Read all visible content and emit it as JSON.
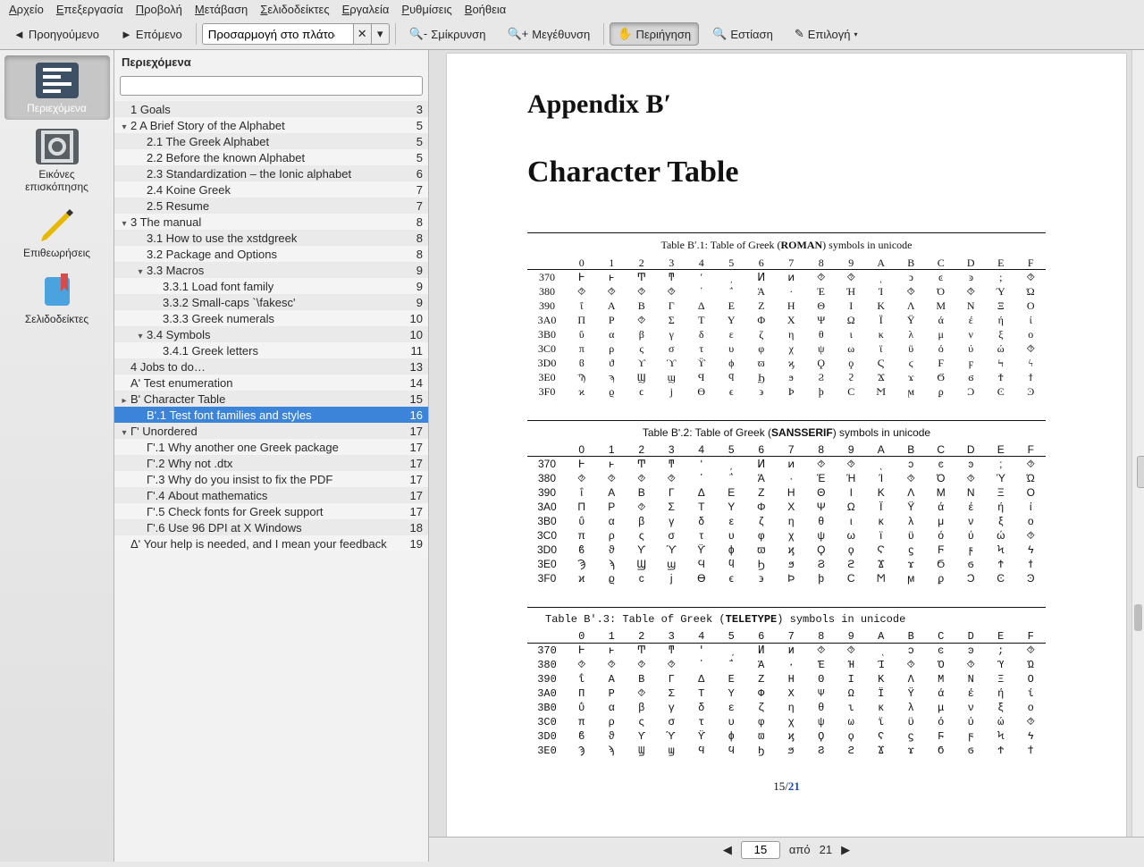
{
  "menu": [
    "Αρχείο",
    "Επεξεργασία",
    "Προβολή",
    "Μετάβαση",
    "Σελιδοδείκτες",
    "Εργαλεία",
    "Ρυθμίσεις",
    "Βοήθεια"
  ],
  "toolbar": {
    "prev": "Προηγούμενο",
    "next": "Επόμενο",
    "zoom_value": "Προσαρμογή στο πλάτος",
    "zoom_out": "Σμίκρυνση",
    "zoom_in": "Μεγέθυνση",
    "browse": "Περιήγηση",
    "focus": "Εστίαση",
    "select": "Επιλογή"
  },
  "sidebar_tabs": {
    "contents": "Περιεχόμενα",
    "thumbnails": "Εικόνες επισκόπησης",
    "reviews": "Επιθεωρήσεις",
    "bookmarks": "Σελιδοδείκτες"
  },
  "panel_title": "Περιεχόμενα",
  "toc": [
    {
      "d": 1,
      "t": "",
      "l": "1 Goals",
      "p": "3"
    },
    {
      "d": 1,
      "t": "v",
      "l": "2 A Brief Story of the Alphabet",
      "p": "5"
    },
    {
      "d": 2,
      "t": "",
      "l": "2.1 The Greek Alphabet",
      "p": "5"
    },
    {
      "d": 2,
      "t": "",
      "l": "2.2 Before the known Alphabet",
      "p": "5"
    },
    {
      "d": 2,
      "t": "",
      "l": "2.3 Standardization – the Ionic alphabet",
      "p": "6"
    },
    {
      "d": 2,
      "t": "",
      "l": "2.4 Koine Greek",
      "p": "7"
    },
    {
      "d": 2,
      "t": "",
      "l": "2.5 Resume",
      "p": "7"
    },
    {
      "d": 1,
      "t": "v",
      "l": "3 The manual",
      "p": "8"
    },
    {
      "d": 2,
      "t": "",
      "l": "3.1 How to use the xstdgreek",
      "p": "8"
    },
    {
      "d": 2,
      "t": "",
      "l": "3.2 Package and Options",
      "p": "8"
    },
    {
      "d": 2,
      "t": "v",
      "l": "3.3 Macros",
      "p": "9"
    },
    {
      "d": 3,
      "t": "",
      "l": "3.3.1 Load font family",
      "p": "9"
    },
    {
      "d": 3,
      "t": "",
      "l": "3.3.2 Small-caps `\\fakesc'",
      "p": "9"
    },
    {
      "d": 3,
      "t": "",
      "l": "3.3.3 Greek numerals",
      "p": "10"
    },
    {
      "d": 2,
      "t": "v",
      "l": "3.4 Symbols",
      "p": "10"
    },
    {
      "d": 3,
      "t": "",
      "l": "3.4.1 Greek letters",
      "p": "11"
    },
    {
      "d": 1,
      "t": "",
      "l": "4 Jobs to do…",
      "p": "13"
    },
    {
      "d": 1,
      "t": "",
      "l": "Αʹ Test enumeration",
      "p": "14"
    },
    {
      "d": 1,
      "t": ">",
      "l": "Βʹ Character Table",
      "p": "15"
    },
    {
      "d": 2,
      "t": "",
      "l": "Βʹ.1 Test font families and styles",
      "p": "16",
      "sel": true
    },
    {
      "d": 1,
      "t": "v",
      "l": "Γʹ Unordered",
      "p": "17"
    },
    {
      "d": 2,
      "t": "",
      "l": "Γʹ.1 Why another one Greek package",
      "p": "17"
    },
    {
      "d": 2,
      "t": "",
      "l": "Γʹ.2 Why not .dtx",
      "p": "17"
    },
    {
      "d": 2,
      "t": "",
      "l": "Γʹ.3 Why do you insist to fix the PDF",
      "p": "17"
    },
    {
      "d": 2,
      "t": "",
      "l": "Γʹ.4 About mathematics",
      "p": "17"
    },
    {
      "d": 2,
      "t": "",
      "l": "Γʹ.5 Check fonts for Greek support",
      "p": "17"
    },
    {
      "d": 2,
      "t": "",
      "l": "Γʹ.6 Use 96 DPI at X Windows",
      "p": "18"
    },
    {
      "d": 1,
      "t": "",
      "l": "Δʹ Your help is needed, and I mean your feedback",
      "p": "19"
    }
  ],
  "doc": {
    "h1": "Appendix Bʹ",
    "h2": "Character Table",
    "table1_cap_pre": "Table Bʹ.1: Table of Greek (",
    "table1_cap_b": "ROMAN",
    "table1_cap_post": ") symbols in unicode",
    "table2_cap_pre": "Table Bʹ.2: Table of Greek (",
    "table2_cap_b": "SANSSERIF",
    "table2_cap_post": ") symbols in unicode",
    "table3_cap_pre": "Table Bʹ.3: Table of Greek (",
    "table3_cap_b": "TELETYPE",
    "table3_cap_post": ") symbols in unicode",
    "cols": [
      "0",
      "1",
      "2",
      "3",
      "4",
      "5",
      "6",
      "7",
      "8",
      "9",
      "A",
      "B",
      "C",
      "D",
      "E",
      "F"
    ],
    "rows": [
      "370",
      "380",
      "390",
      "3A0",
      "3B0",
      "3C0",
      "3D0",
      "3E0",
      "3F0"
    ],
    "rows_t3": [
      "370",
      "380",
      "390",
      "3A0",
      "3B0",
      "3C0",
      "3D0",
      "3E0"
    ],
    "grid": {
      "370": [
        "Ͱ",
        "ͱ",
        "Ͳ",
        "ͳ",
        "ʹ",
        "͵",
        "Ͷ",
        "ͷ",
        "⯑",
        "⯑",
        "ͺ",
        "ͻ",
        "ͼ",
        "ͽ",
        ";",
        "⯑"
      ],
      "380": [
        "⯑",
        "⯑",
        "⯑",
        "⯑",
        "΄",
        "΅",
        "Ά",
        "·",
        "Έ",
        "Ή",
        "Ί",
        "⯑",
        "Ό",
        "⯑",
        "Ύ",
        "Ώ"
      ],
      "390": [
        "ΐ",
        "Α",
        "Β",
        "Γ",
        "Δ",
        "Ε",
        "Ζ",
        "Η",
        "Θ",
        "Ι",
        "Κ",
        "Λ",
        "Μ",
        "Ν",
        "Ξ",
        "Ο"
      ],
      "3A0": [
        "Π",
        "Ρ",
        "⯑",
        "Σ",
        "Τ",
        "Υ",
        "Φ",
        "Χ",
        "Ψ",
        "Ω",
        "Ϊ",
        "Ϋ",
        "ά",
        "έ",
        "ή",
        "ί"
      ],
      "3B0": [
        "ΰ",
        "α",
        "β",
        "γ",
        "δ",
        "ε",
        "ζ",
        "η",
        "θ",
        "ι",
        "κ",
        "λ",
        "μ",
        "ν",
        "ξ",
        "ο"
      ],
      "3C0": [
        "π",
        "ρ",
        "ς",
        "σ",
        "τ",
        "υ",
        "φ",
        "χ",
        "ψ",
        "ω",
        "ϊ",
        "ϋ",
        "ό",
        "ύ",
        "ώ",
        "⯑"
      ],
      "3D0": [
        "ϐ",
        "ϑ",
        "ϒ",
        "ϓ",
        "ϔ",
        "ϕ",
        "ϖ",
        "ϗ",
        "Ϙ",
        "ϙ",
        "Ϛ",
        "ϛ",
        "Ϝ",
        "ϝ",
        "Ϟ",
        "ϟ"
      ],
      "3E0": [
        "Ϡ",
        "ϡ",
        "Ϣ",
        "ϣ",
        "Ϥ",
        "ϥ",
        "Ϧ",
        "ϧ",
        "Ϩ",
        "ϩ",
        "Ϫ",
        "ϫ",
        "Ϭ",
        "ϭ",
        "Ϯ",
        "ϯ"
      ],
      "3F0": [
        "ϰ",
        "ϱ",
        "ϲ",
        "ϳ",
        "ϴ",
        "ϵ",
        "϶",
        "Ϸ",
        "ϸ",
        "Ϲ",
        "Ϻ",
        "ϻ",
        "ϼ",
        "Ͻ",
        "Ͼ",
        "Ͽ"
      ]
    },
    "pagenum_cur": "15",
    "pagenum_sep": "/",
    "pagenum_tot": "21"
  },
  "status": {
    "page_input": "15",
    "of": "από",
    "total": "21"
  }
}
